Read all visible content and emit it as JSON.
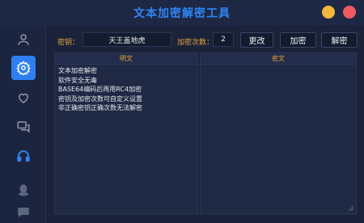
{
  "window": {
    "title": "文本加密解密工具",
    "colors": {
      "title": "#2f86f6",
      "minimize": "#f3b63c",
      "close": "#ee5a63",
      "accent": "#2f7ff0",
      "label": "#e8a23a"
    }
  },
  "sidebar": {
    "items": [
      {
        "icon": "user-icon",
        "active": false
      },
      {
        "icon": "gear-icon",
        "active": true
      },
      {
        "icon": "heart-icon",
        "active": false
      },
      {
        "icon": "chat-icon",
        "active": false
      },
      {
        "icon": "headphones-icon",
        "active": false
      },
      {
        "icon": "qq-penguin-icon",
        "active": false
      },
      {
        "icon": "message-icon",
        "active": false
      }
    ]
  },
  "controls": {
    "key_label": "密钥：",
    "key_value": "天王盖地虎",
    "count_label": "加密次数：",
    "count_value": "2",
    "change_button": "更改",
    "encrypt_button": "加密",
    "decrypt_button": "解密"
  },
  "plaintext": {
    "header": "明文",
    "lines": [
      "文本加密解密",
      "软件安全无毒",
      "BASE64编码后再用RC4加密",
      "密钥及加密次数可自定义设置",
      "非正确密钥正确次数无法解密"
    ]
  },
  "ciphertext": {
    "header": "密文",
    "lines": []
  }
}
